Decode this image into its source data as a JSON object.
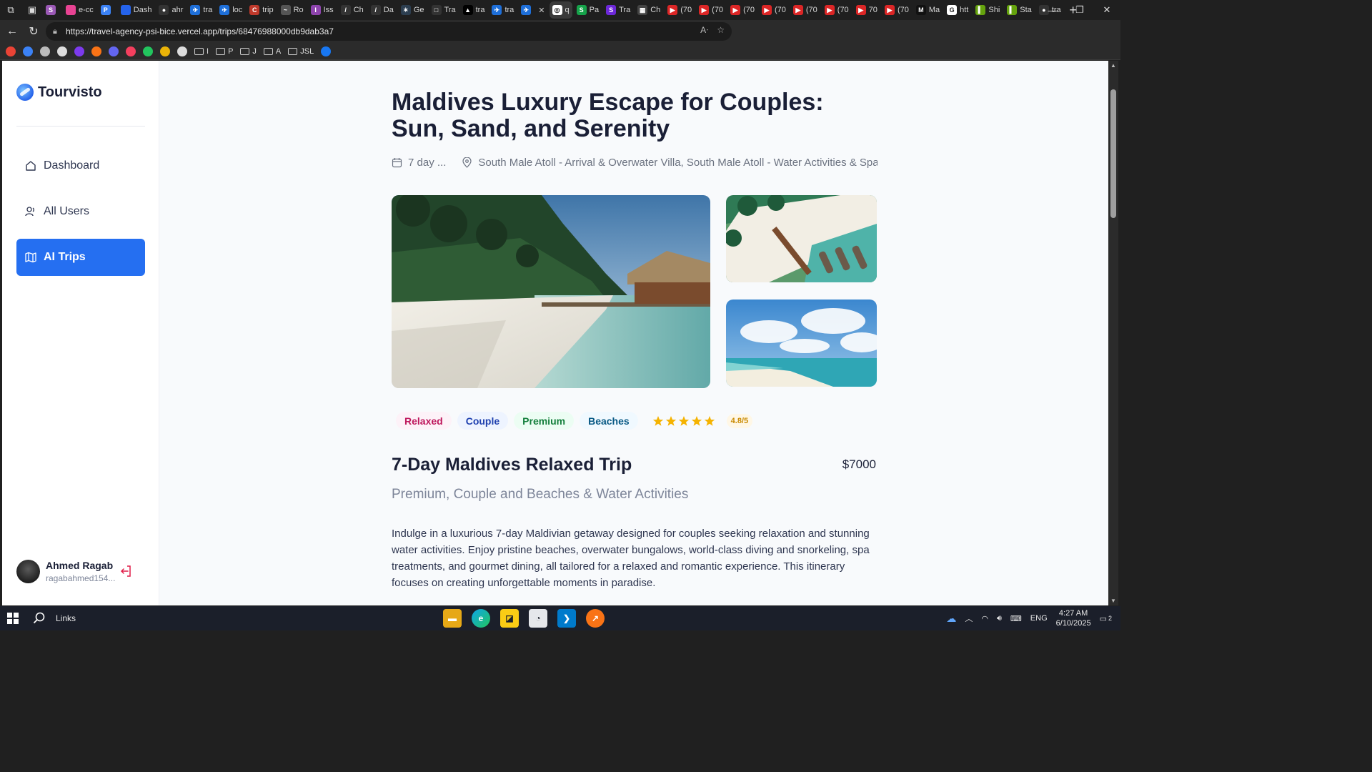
{
  "browser": {
    "tabs": [
      {
        "label": "",
        "color": "#9b59b6",
        "glyph": "S"
      },
      {
        "label": "e-cc",
        "color": "#e84393",
        "glyph": ""
      },
      {
        "label": "",
        "color": "#3b82f6",
        "glyph": "P"
      },
      {
        "label": "Dash",
        "color": "#2563eb",
        "glyph": ""
      },
      {
        "label": "ahr",
        "color": "#333",
        "glyph": "●"
      },
      {
        "label": "tra",
        "color": "#1e6fd9",
        "glyph": "✈"
      },
      {
        "label": "loc",
        "color": "#1e6fd9",
        "glyph": "✈"
      },
      {
        "label": "trip",
        "color": "#c0392b",
        "glyph": "C"
      },
      {
        "label": "Ro",
        "color": "#555",
        "glyph": "~"
      },
      {
        "label": "Iss",
        "color": "#8e44ad",
        "glyph": "I"
      },
      {
        "label": "Ch",
        "color": "#333",
        "glyph": "/"
      },
      {
        "label": "Da",
        "color": "#333",
        "glyph": "/"
      },
      {
        "label": "Ge",
        "color": "#2c3e50",
        "glyph": "✶"
      },
      {
        "label": "Tra",
        "color": "#333",
        "glyph": "□"
      },
      {
        "label": "tra",
        "color": "#000",
        "glyph": "▲"
      },
      {
        "label": "tra",
        "color": "#1e6fd9",
        "glyph": "✈"
      },
      {
        "label": "",
        "color": "#1e6fd9",
        "glyph": "✈"
      },
      {
        "label": "q",
        "color": "#fff",
        "glyph": "◎"
      },
      {
        "label": "Pa",
        "color": "#16a34a",
        "glyph": "S"
      },
      {
        "label": "Tra",
        "color": "#6d28d9",
        "glyph": "S"
      },
      {
        "label": "Ch",
        "color": "#444",
        "glyph": "▦"
      },
      {
        "label": "(70",
        "color": "#dc2626",
        "glyph": "▶"
      },
      {
        "label": "(70",
        "color": "#dc2626",
        "glyph": "▶"
      },
      {
        "label": "(70",
        "color": "#dc2626",
        "glyph": "▶"
      },
      {
        "label": "(70",
        "color": "#dc2626",
        "glyph": "▶"
      },
      {
        "label": "(70",
        "color": "#dc2626",
        "glyph": "▶"
      },
      {
        "label": "(70",
        "color": "#dc2626",
        "glyph": "▶"
      },
      {
        "label": "70",
        "color": "#dc2626",
        "glyph": "▶"
      },
      {
        "label": "(70",
        "color": "#dc2626",
        "glyph": "▶"
      },
      {
        "label": "Ma",
        "color": "#111",
        "glyph": "M"
      },
      {
        "label": "htt",
        "color": "#fff",
        "glyph": "G"
      },
      {
        "label": "Shi",
        "color": "#65a30d",
        "glyph": "▍"
      },
      {
        "label": "Sta",
        "color": "#65a30d",
        "glyph": "▍"
      },
      {
        "label": "tra",
        "color": "#333",
        "glyph": "●"
      }
    ],
    "url": "https://travel-agency-psi-bice.vercel.app/trips/68476988000db9dab3a7",
    "bookmarks": [
      {
        "label": "",
        "type": "icon",
        "color": "#ea4335"
      },
      {
        "label": "",
        "type": "icon",
        "color": "#3b82f6"
      },
      {
        "label": "",
        "type": "icon",
        "color": "#bbb"
      },
      {
        "label": "",
        "type": "icon",
        "color": "#ddd"
      },
      {
        "label": "",
        "type": "icon",
        "color": "#7c3aed"
      },
      {
        "label": "",
        "type": "icon",
        "color": "#f97316"
      },
      {
        "label": "",
        "type": "icon",
        "color": "#6366f1"
      },
      {
        "label": "",
        "type": "icon",
        "color": "#f43f5e"
      },
      {
        "label": "",
        "type": "icon",
        "color": "#22c55e"
      },
      {
        "label": "",
        "type": "icon",
        "color": "#eab308"
      },
      {
        "label": "",
        "type": "icon",
        "color": "#ddd"
      },
      {
        "label": "I",
        "type": "folder",
        "color": ""
      },
      {
        "label": "P",
        "type": "folder",
        "color": ""
      },
      {
        "label": "J",
        "type": "folder",
        "color": ""
      },
      {
        "label": "A",
        "type": "folder",
        "color": ""
      },
      {
        "label": "JSL",
        "type": "folder",
        "color": ""
      },
      {
        "label": "",
        "type": "icon",
        "color": "#1877f2"
      }
    ]
  },
  "sidebar": {
    "brand": "Tourvisto",
    "items": [
      {
        "label": "Dashboard",
        "icon": "home-icon",
        "active": false
      },
      {
        "label": "All Users",
        "icon": "users-icon",
        "active": false
      },
      {
        "label": "AI Trips",
        "icon": "map-icon",
        "active": true
      }
    ],
    "user": {
      "name": "Ahmed Ragab",
      "email": "ragabahmed154..."
    }
  },
  "trip": {
    "title": "Maldives Luxury Escape for Couples: Sun, Sand, and Serenity",
    "duration": "7 day ...",
    "locations": "South Male Atoll - Arrival & Overwater Villa, South Male Atoll - Water Activities & Spa, N",
    "tags": [
      {
        "label": "Relaxed",
        "bg": "#fdf2f8",
        "fg": "#be185d"
      },
      {
        "label": "Couple",
        "bg": "#eef4ff",
        "fg": "#1e40af"
      },
      {
        "label": "Premium",
        "bg": "#ecfdf3",
        "fg": "#15803d"
      },
      {
        "label": "Beaches",
        "bg": "#f0f9ff",
        "fg": "#075985"
      }
    ],
    "stars": 5,
    "rating": "4.8/5",
    "heading": "7-Day Maldives Relaxed Trip",
    "price": "$7000",
    "subheading": "Premium, Couple and Beaches & Water Activities",
    "description": "Indulge in a luxurious 7-day Maldivian getaway designed for couples seeking relaxation and stunning water activities. Enjoy pristine beaches, overwater bungalows, world-class diving and snorkeling, spa treatments, and gourmet dining, all tailored for a relaxed and romantic experience. This itinerary focuses on creating unforgettable moments in paradise."
  },
  "taskbar": {
    "search_label": "Links",
    "language": "ENG",
    "time": "4:27 AM",
    "date": "6/10/2025",
    "notification_count": "2"
  }
}
